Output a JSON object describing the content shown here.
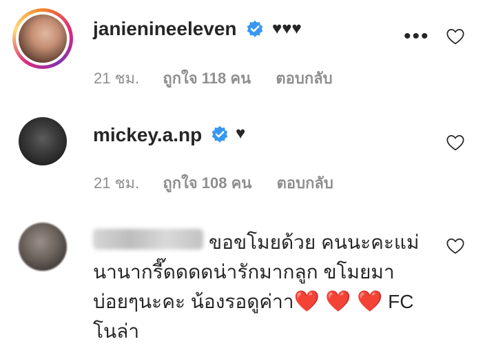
{
  "comments": [
    {
      "username": "janienineeleven",
      "text": "♥♥♥",
      "time": "21 ชม.",
      "likes": "ถูกใจ 118 คน",
      "reply": "ตอบกลับ",
      "verified": true,
      "more_label": "•••"
    },
    {
      "username": "mickey.a.np",
      "text": "♥",
      "time": "21 ชม.",
      "likes": "ถูกใจ 108 คน",
      "reply": "ตอบกลับ",
      "verified": true
    },
    {
      "username": "",
      "line1": "ขอขโมยด้วย คนนะคะแม่",
      "line2": "นานากรี๊ดดดดน่ารักมากลูก ขโมยมา",
      "line3_prefix": "บ่อยๆนะคะ น้องรอดูค่าา",
      "line3_hearts": "❤️ ❤️ ❤️",
      "line3_suffix": " FC",
      "line4": "โนล่า"
    }
  ],
  "colors": {
    "verified_blue": "#3897f0",
    "meta_gray": "#8e8e8e",
    "text_dark": "#262626",
    "heart_red": "#d91a2a"
  },
  "icons": {
    "like": "heart-outline-icon",
    "verified": "verified-badge-icon",
    "more": "more-options-icon"
  }
}
